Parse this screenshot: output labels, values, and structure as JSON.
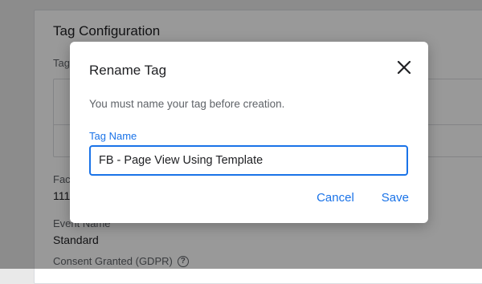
{
  "background": {
    "card_title": "Tag Configuration",
    "tag_label": "Tag",
    "facebook_label": "Fac",
    "facebook_value": "111",
    "event_name_label": "Event Name",
    "event_name_value": "Standard",
    "consent_label": "Consent Granted (GDPR)",
    "help_icon": "help-circle-icon"
  },
  "dialog": {
    "title": "Rename Tag",
    "close_icon": "close-icon",
    "message": "You must name your tag before creation.",
    "field_label": "Tag Name",
    "field_value": "FB - Page View Using Template",
    "cancel_label": "Cancel",
    "save_label": "Save"
  },
  "colors": {
    "accent": "#1a73e8",
    "scrim": "rgba(0,0,0,0.40)"
  }
}
